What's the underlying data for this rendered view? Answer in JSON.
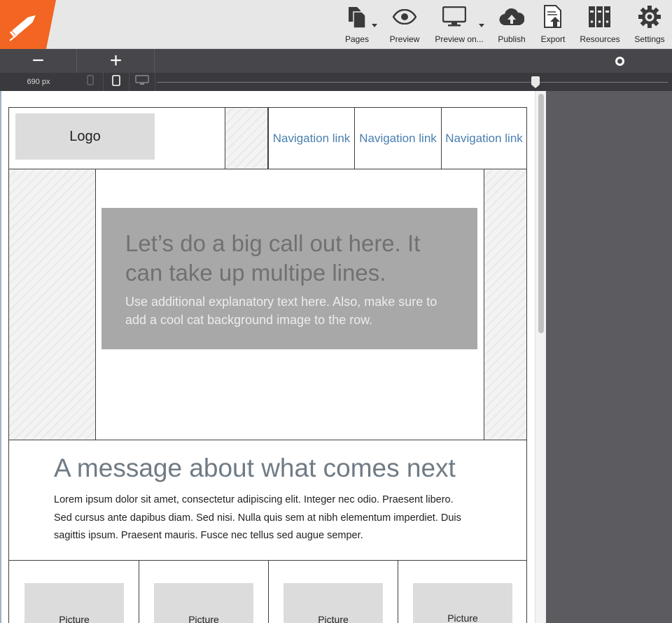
{
  "toolbar": {
    "items": [
      {
        "label": "Pages",
        "icon": "pages-icon"
      },
      {
        "label": "Preview",
        "icon": "eye-icon"
      },
      {
        "label": "Preview on...",
        "icon": "monitor-icon"
      },
      {
        "label": "Publish",
        "icon": "cloud-upload-icon"
      },
      {
        "label": "Export",
        "icon": "export-icon"
      },
      {
        "label": "Resources",
        "icon": "binders-icon"
      },
      {
        "label": "Settings",
        "icon": "gear-icon"
      }
    ],
    "brand_color": "#f26522"
  },
  "zoom": {
    "minus": "−",
    "plus": "+"
  },
  "viewport": {
    "width_label": "690 px"
  },
  "wireframe": {
    "logo": "Logo",
    "nav_links": [
      "Navigation link",
      "Navigation link",
      "Navigation link"
    ],
    "callout_title": "Let’s do a big call out here. It can take up multipe lines.",
    "callout_text": "Use additional explanatory text here. Also, make sure to add a cool cat background image to the row.",
    "message_title": "A message about what comes next",
    "message_body": "Lorem ipsum dolor sit amet, consectetur adipiscing elit. Integer nec odio. Praesent libero. Sed cursus ante dapibus diam. Sed nisi. Nulla quis sem at nibh elementum imperdiet. Duis sagittis ipsum. Praesent mauris. Fusce nec tellus sed augue semper.",
    "pictures": [
      "Picture",
      "Picture",
      "Picture",
      "Picture"
    ]
  }
}
